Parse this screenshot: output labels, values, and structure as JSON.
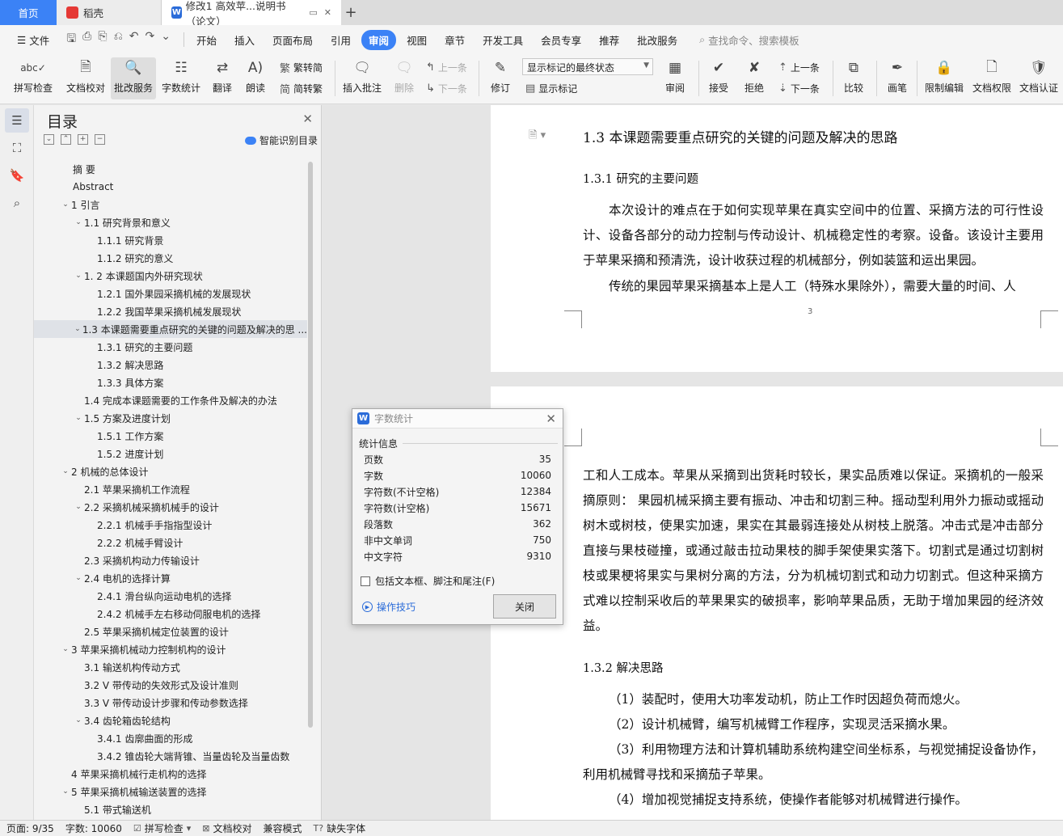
{
  "tabs": {
    "home": "首页",
    "daoke": "稻壳",
    "doc": "修改1 高效苹...说明书（论文）"
  },
  "menu": {
    "file": "文件",
    "items": [
      "开始",
      "插入",
      "页面布局",
      "引用",
      "审阅",
      "视图",
      "章节",
      "开发工具",
      "会员专享",
      "推荐",
      "批改服务"
    ],
    "active": "审阅",
    "search": "查找命令、搜索模板"
  },
  "ribbon": {
    "spell": "拼写检查",
    "doc_check": "文档校对",
    "review_service": "批改服务",
    "word_count": "字数统计",
    "translate": "翻译",
    "read_aloud": "朗读",
    "to_traditional": "繁转简",
    "to_simplified": "简转繁",
    "insert_comment": "插入批注",
    "delete": "删除",
    "prev": "上一条",
    "next": "下一条",
    "revise": "修订",
    "markup_select": "显示标记的最终状态",
    "show_markup": "显示标记",
    "review": "审阅",
    "accept": "接受",
    "reject": "拒绝",
    "prev2": "上一条",
    "next2": "下一条",
    "compare": "比较",
    "pen": "画笔",
    "restrict": "限制编辑",
    "doc_permission": "文档权限",
    "doc_auth": "文档认证"
  },
  "toc": {
    "title": "目录",
    "smart": "智能识别目录",
    "items": [
      {
        "label": "摘    要",
        "level": 0,
        "chev": false
      },
      {
        "label": "Abstract",
        "level": 0,
        "chev": false
      },
      {
        "label": "1 引言",
        "level": 1,
        "chev": true
      },
      {
        "label": "1.1 研究背景和意义",
        "level": 2,
        "chev": true
      },
      {
        "label": "1.1.1 研究背景",
        "level": 3,
        "chev": false
      },
      {
        "label": "1.1.2 研究的意义",
        "level": 3,
        "chev": false
      },
      {
        "label": "1. 2 本课题国内外研究现状",
        "level": 2,
        "chev": true
      },
      {
        "label": "1.2.1 国外果园采摘机械的发展现状",
        "level": 3,
        "chev": false
      },
      {
        "label": "1.2.2 我国苹果采摘机械发展现状",
        "level": 3,
        "chev": false
      },
      {
        "label": "1.3 本课题需要重点研究的关键的问题及解决的思 ...",
        "level": 2,
        "chev": true,
        "selected": true
      },
      {
        "label": "1.3.1  研究的主要问题",
        "level": 3,
        "chev": false
      },
      {
        "label": "1.3.2  解决思路",
        "level": 3,
        "chev": false
      },
      {
        "label": "1.3.3 具体方案",
        "level": 3,
        "chev": false
      },
      {
        "label": "1.4 完成本课题需要的工作条件及解决的办法",
        "level": 2,
        "chev": false
      },
      {
        "label": "1.5  方案及进度计划",
        "level": 2,
        "chev": true
      },
      {
        "label": "1.5.1  工作方案",
        "level": 3,
        "chev": false
      },
      {
        "label": "1.5.2 进度计划",
        "level": 3,
        "chev": false
      },
      {
        "label": "2 机械的总体设计",
        "level": 1,
        "chev": true
      },
      {
        "label": "2.1 苹果采摘机工作流程",
        "level": 2,
        "chev": false
      },
      {
        "label": "2.2 采摘机械采摘机械手的设计",
        "level": 2,
        "chev": true
      },
      {
        "label": "2.2.1 机械手手指指型设计",
        "level": 3,
        "chev": false
      },
      {
        "label": "2.2.2 机械手臂设计",
        "level": 3,
        "chev": false
      },
      {
        "label": "2.3 采摘机构动力传输设计",
        "level": 2,
        "chev": false
      },
      {
        "label": "2.4 电机的选择计算",
        "level": 2,
        "chev": true
      },
      {
        "label": "2.4.1 滑台纵向运动电机的选择",
        "level": 3,
        "chev": false
      },
      {
        "label": "2.4.2 机械手左右移动伺服电机的选择",
        "level": 3,
        "chev": false
      },
      {
        "label": "2.5 苹果采摘机械定位装置的设计",
        "level": 2,
        "chev": false
      },
      {
        "label": "3 苹果采摘机械动力控制机构的设计",
        "level": 1,
        "chev": true
      },
      {
        "label": "3.1 输送机构传动方式",
        "level": 2,
        "chev": false
      },
      {
        "label": "3.2 V 带传动的失效形式及设计准则",
        "level": 2,
        "chev": false
      },
      {
        "label": "3.3 V 带传动设计步骤和传动参数选择",
        "level": 2,
        "chev": false
      },
      {
        "label": "3.4 齿轮箱齿轮结构",
        "level": 2,
        "chev": true
      },
      {
        "label": "3.4.1 齿廓曲面的形成",
        "level": 3,
        "chev": false
      },
      {
        "label": "3.4.2 锥齿轮大端背锥、当量齿轮及当量齿数",
        "level": 3,
        "chev": false
      },
      {
        "label": "4 苹果采摘机械行走机构的选择",
        "level": 1,
        "chev": false
      },
      {
        "label": "5 苹果采摘机械输送装置的选择",
        "level": 1,
        "chev": true
      },
      {
        "label": "5.1 带式输送机",
        "level": 2,
        "chev": false
      }
    ]
  },
  "doc": {
    "page1": {
      "h2": "1.3 本课题需要重点研究的关键的问题及解决的思路",
      "h3": "1.3.1  研究的主要问题",
      "p1": "本次设计的难点在于如何实现苹果在真实空间中的位置、采摘方法的可行性设计、设备各部分的动力控制与传动设计、机械稳定性的考察。设备。该设计主要用于苹果采摘和预清洗，设计收获过程的机械部分，例如装篮和运出果园。",
      "p2": "传统的果园苹果采摘基本上是人工（特殊水果除外），需要大量的时间、人",
      "page_number": "3"
    },
    "page2": {
      "p1": "工和人工成本。苹果从采摘到出货耗时较长，果实品质难以保证。采摘机的一般采摘原则：  果园机械采摘主要有振动、冲击和切割三种。摇动型利用外力振动或摇动树木或树枝，使果实加速，果实在其最弱连接处从树枝上脱落。冲击式是冲击部分直接与果枝碰撞，或通过敲击拉动果枝的脚手架使果实落下。切割式是通过切割树枝或果梗将果实与果树分离的方法，分为机械切割式和动力切割式。但这种采摘方式难以控制采收后的苹果果实的破损率，影响苹果品质，无助于增加果园的经济效益。",
      "h3": "1.3.2  解决思路",
      "items": [
        "（1）装配时，使用大功率发动机，防止工作时因超负荷而熄火。",
        "（2）设计机械臂，编写机械臂工作程序，实现灵活采摘水果。",
        "（3）利用物理方法和计算机辅助系统构建空间坐标系，与视觉捕捉设备协作，利用机械臂寻找和采摘茄子苹果。",
        "（4）增加视觉捕捉支持系统，使操作者能够对机械臂进行操作。"
      ]
    }
  },
  "dialog": {
    "title": "字数统计",
    "section": "统计信息",
    "rows": [
      {
        "label": "页数",
        "value": "35"
      },
      {
        "label": "字数",
        "value": "10060"
      },
      {
        "label": "字符数(不计空格)",
        "value": "12384"
      },
      {
        "label": "字符数(计空格)",
        "value": "15671"
      },
      {
        "label": "段落数",
        "value": "362"
      },
      {
        "label": "非中文单词",
        "value": "750"
      },
      {
        "label": "中文字符",
        "value": "9310"
      }
    ],
    "checkbox": "包括文本框、脚注和尾注(F)",
    "tips": "操作技巧",
    "close": "关闭"
  },
  "status": {
    "page": "页面: 9/35",
    "words": "字数: 10060",
    "spell": "拼写检查",
    "doc_check": "文档校对",
    "compat": "兼容模式",
    "missing_font": "缺失字体"
  }
}
